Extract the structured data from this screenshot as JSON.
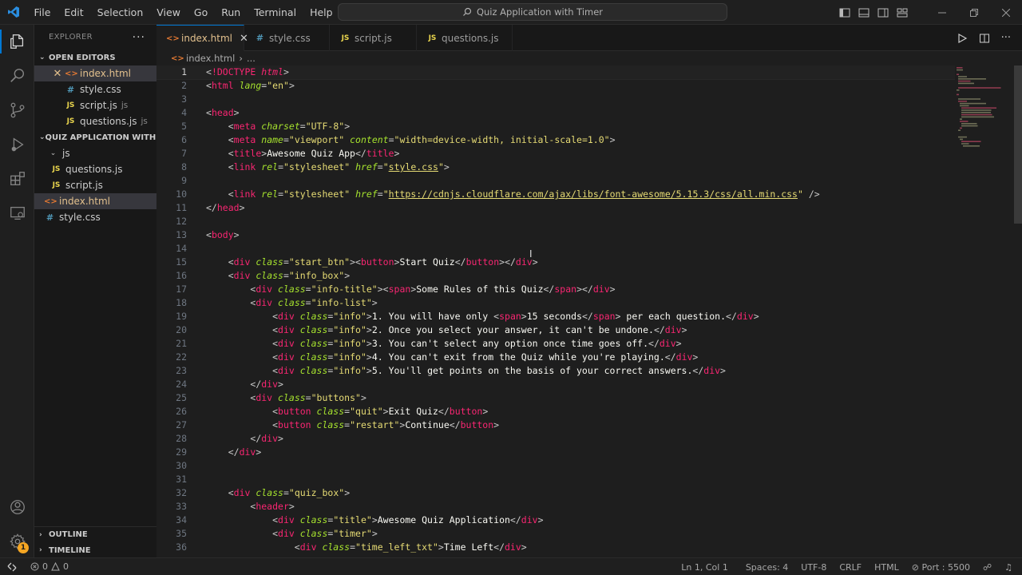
{
  "titlebar": {
    "menu": [
      "File",
      "Edit",
      "Selection",
      "View",
      "Go",
      "Run",
      "Terminal",
      "Help"
    ],
    "search_text": "Quiz Application with Timer"
  },
  "sidebar": {
    "header": "EXPLORER",
    "open_editors_label": "OPEN EDITORS",
    "open_editors": [
      {
        "name": "index.html",
        "type": "html",
        "dir": ""
      },
      {
        "name": "style.css",
        "type": "css",
        "dir": ""
      },
      {
        "name": "script.js",
        "type": "js",
        "dir": "js"
      },
      {
        "name": "questions.js",
        "type": "js",
        "dir": "js"
      }
    ],
    "project_label": "QUIZ APPLICATION WITH ...",
    "tree": {
      "folder": "js",
      "folder_files": [
        "questions.js",
        "script.js"
      ],
      "root_files": [
        "index.html",
        "style.css"
      ]
    },
    "outline_label": "OUTLINE",
    "timeline_label": "TIMELINE"
  },
  "tabs": [
    {
      "name": "index.html",
      "type": "html"
    },
    {
      "name": "style.css",
      "type": "css"
    },
    {
      "name": "script.js",
      "type": "js"
    },
    {
      "name": "questions.js",
      "type": "js"
    }
  ],
  "breadcrumb": {
    "file": "index.html",
    "more": "..."
  },
  "code_lines": [
    "<!DOCTYPE html>",
    "<html lang=\"en\">",
    "",
    "<head>",
    "    <meta charset=\"UTF-8\">",
    "    <meta name=\"viewport\" content=\"width=device-width, initial-scale=1.0\">",
    "    <title>Awesome Quiz App</title>",
    "    <link rel=\"stylesheet\" href=\"style.css\">",
    "",
    "    <link rel=\"stylesheet\" href=\"https://cdnjs.cloudflare.com/ajax/libs/font-awesome/5.15.3/css/all.min.css\" />",
    "</head>",
    "",
    "<body>",
    "",
    "    <div class=\"start_btn\"><button>Start Quiz</button></div>",
    "    <div class=\"info_box\">",
    "        <div class=\"info-title\"><span>Some Rules of this Quiz</span></div>",
    "        <div class=\"info-list\">",
    "            <div class=\"info\">1. You will have only <span>15 seconds</span> per each question.</div>",
    "            <div class=\"info\">2. Once you select your answer, it can't be undone.</div>",
    "            <div class=\"info\">3. You can't select any option once time goes off.</div>",
    "            <div class=\"info\">4. You can't exit from the Quiz while you're playing.</div>",
    "            <div class=\"info\">5. You'll get points on the basis of your correct answers.</div>",
    "        </div>",
    "        <div class=\"buttons\">",
    "            <button class=\"quit\">Exit Quiz</button>",
    "            <button class=\"restart\">Continue</button>",
    "        </div>",
    "    </div>",
    "",
    "",
    "    <div class=\"quiz_box\">",
    "        <header>",
    "            <div class=\"title\">Awesome Quiz Application</div>",
    "            <div class=\"timer\">",
    "                <div class=\"time_left_txt\">Time Left</div>"
  ],
  "statusbar": {
    "errors": "0",
    "warnings": "0",
    "position": "Ln 1, Col 1",
    "spaces": "Spaces: 4",
    "encoding": "UTF-8",
    "eol": "CRLF",
    "language": "HTML",
    "port": "Port : 5500"
  },
  "badge_count": "1",
  "colors": {
    "accent": "#0078d4",
    "modified": "#e2c08d",
    "badge": "#f5a623"
  }
}
